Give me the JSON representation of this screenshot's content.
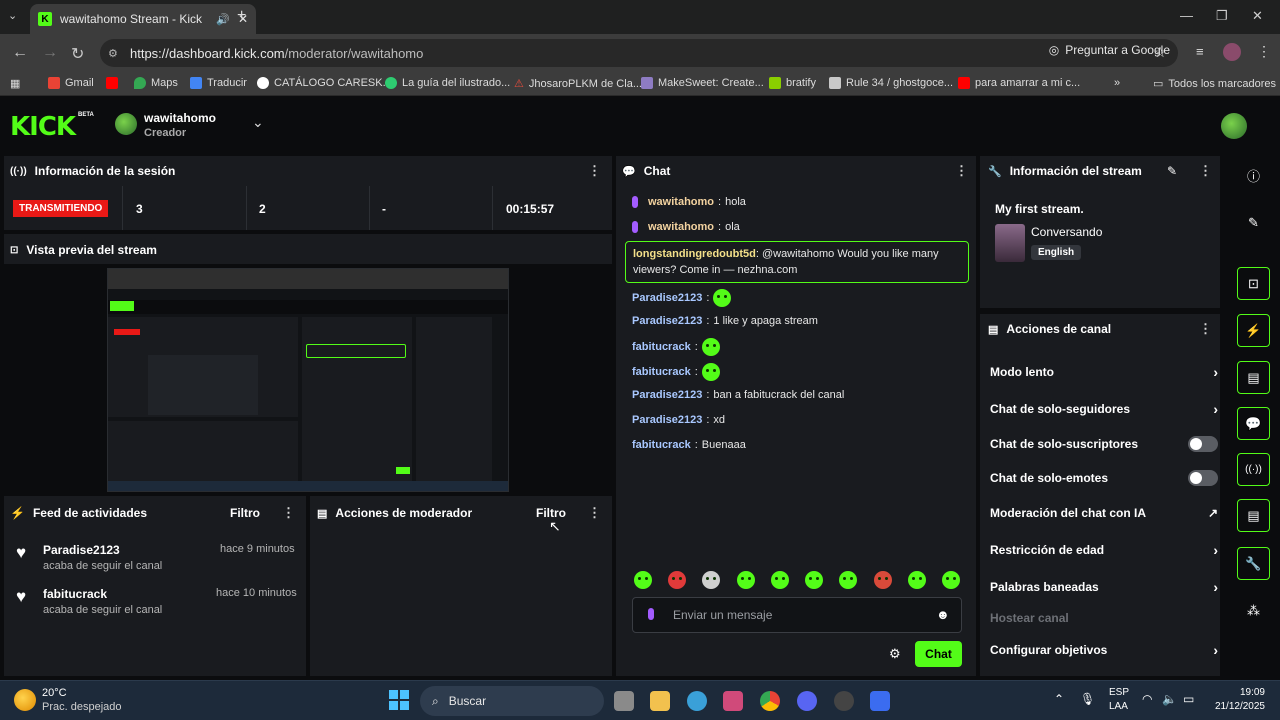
{
  "browser": {
    "tab_title": "wawitahomo Stream - Kick",
    "tab_favicon": "K",
    "url_host": "https://dashboard.kick.com",
    "url_path": "/moderator/wawitahomo",
    "ask_google": "Preguntar a Google",
    "bookmarks": [
      {
        "label": "Gmail",
        "color": "#ea4335"
      },
      {
        "label": "",
        "color": "#ff0000"
      },
      {
        "label": "Maps",
        "color": "#34a853"
      },
      {
        "label": "Traducir",
        "color": "#4285f4"
      },
      {
        "label": "CATÁLOGO CARESK...",
        "color": "#ffffff"
      },
      {
        "label": "La guía del ilustrado...",
        "color": "#2ecc71"
      },
      {
        "label": "JhosaroPLKM de Cla...",
        "color": "#e74c3c"
      },
      {
        "label": "MakeSweet: Create...",
        "color": "#8e7cc3"
      },
      {
        "label": "bratify",
        "color": "#8ace00"
      },
      {
        "label": "Rule 34 / ghostgoce...",
        "color": "#c8c8c8"
      },
      {
        "label": "para amarrar a mi c...",
        "color": "#ff0000"
      }
    ],
    "all_bookmarks": "Todos los marcadores"
  },
  "header": {
    "logo": "KICK",
    "beta": "BETA",
    "channel_name": "wawitahomo",
    "channel_role": "Creador"
  },
  "session": {
    "title": "Información de la sesión",
    "live_label": "TRANSMITIENDO",
    "stat1": "3",
    "stat2": "2",
    "stat3": "-",
    "duration": "00:15:57"
  },
  "preview": {
    "title": "Vista previa del stream"
  },
  "feed": {
    "title": "Feed de actividades",
    "filter": "Filtro",
    "items": [
      {
        "user": "Paradise2123",
        "time": "hace 9 minutos",
        "desc": "acaba de seguir el canal"
      },
      {
        "user": "fabitucrack",
        "time": "hace 10 minutos",
        "desc": "acaba de seguir el canal"
      }
    ]
  },
  "mod_actions": {
    "title": "Acciones de moderador",
    "filter": "Filtro"
  },
  "chat": {
    "title": "Chat",
    "messages": [
      {
        "user": "wawitahomo",
        "text": "hola"
      },
      {
        "user": "wawitahomo",
        "text": "ola"
      },
      {
        "user": "longstandingredoubt5d",
        "text": "@wawitahomo Would you like many",
        "text2": "viewers? Come in — nezhna.com"
      },
      {
        "user": "Paradise2123",
        "text": ""
      },
      {
        "user": "Paradise2123",
        "text": "1 like y apaga stream"
      },
      {
        "user": "fabitucrack",
        "text": ""
      },
      {
        "user": "fabitucrack",
        "text": ""
      },
      {
        "user": "Paradise2123",
        "text": "ban a fabitucrack del canal"
      },
      {
        "user": "Paradise2123",
        "text": "xd"
      },
      {
        "user": "fabitucrack",
        "text": "Buenaaa"
      }
    ],
    "input_placeholder": "Enviar un mensaje",
    "send_label": "Chat"
  },
  "stream_info": {
    "title": "Información del stream",
    "stream_title": "My first stream.",
    "category": "Conversando",
    "language": "English"
  },
  "channel_actions": {
    "title": "Acciones de canal",
    "items": [
      {
        "label": "Modo lento",
        "type": "chevron"
      },
      {
        "label": "Chat de solo-seguidores",
        "type": "chevron"
      },
      {
        "label": "Chat de solo-suscriptores",
        "type": "toggle"
      },
      {
        "label": "Chat de solo-emotes",
        "type": "toggle"
      },
      {
        "label": "Moderación del chat con IA",
        "type": "external"
      },
      {
        "label": "Restricción de edad",
        "type": "chevron"
      },
      {
        "label": "Palabras baneadas",
        "type": "chevron"
      },
      {
        "label": "Hostear canal",
        "type": "disabled"
      },
      {
        "label": "Configurar objetivos",
        "type": "chevron"
      }
    ]
  },
  "taskbar": {
    "weather_temp": "20°C",
    "weather_desc": "Prac. despejado",
    "search": "Buscar",
    "lang1": "ESP",
    "lang2": "LAA",
    "time": "19:09",
    "date": "21/12/2025"
  },
  "colors": {
    "kick_green": "#53fc18",
    "live_red": "#e91916",
    "panel_bg": "#191b1f"
  }
}
